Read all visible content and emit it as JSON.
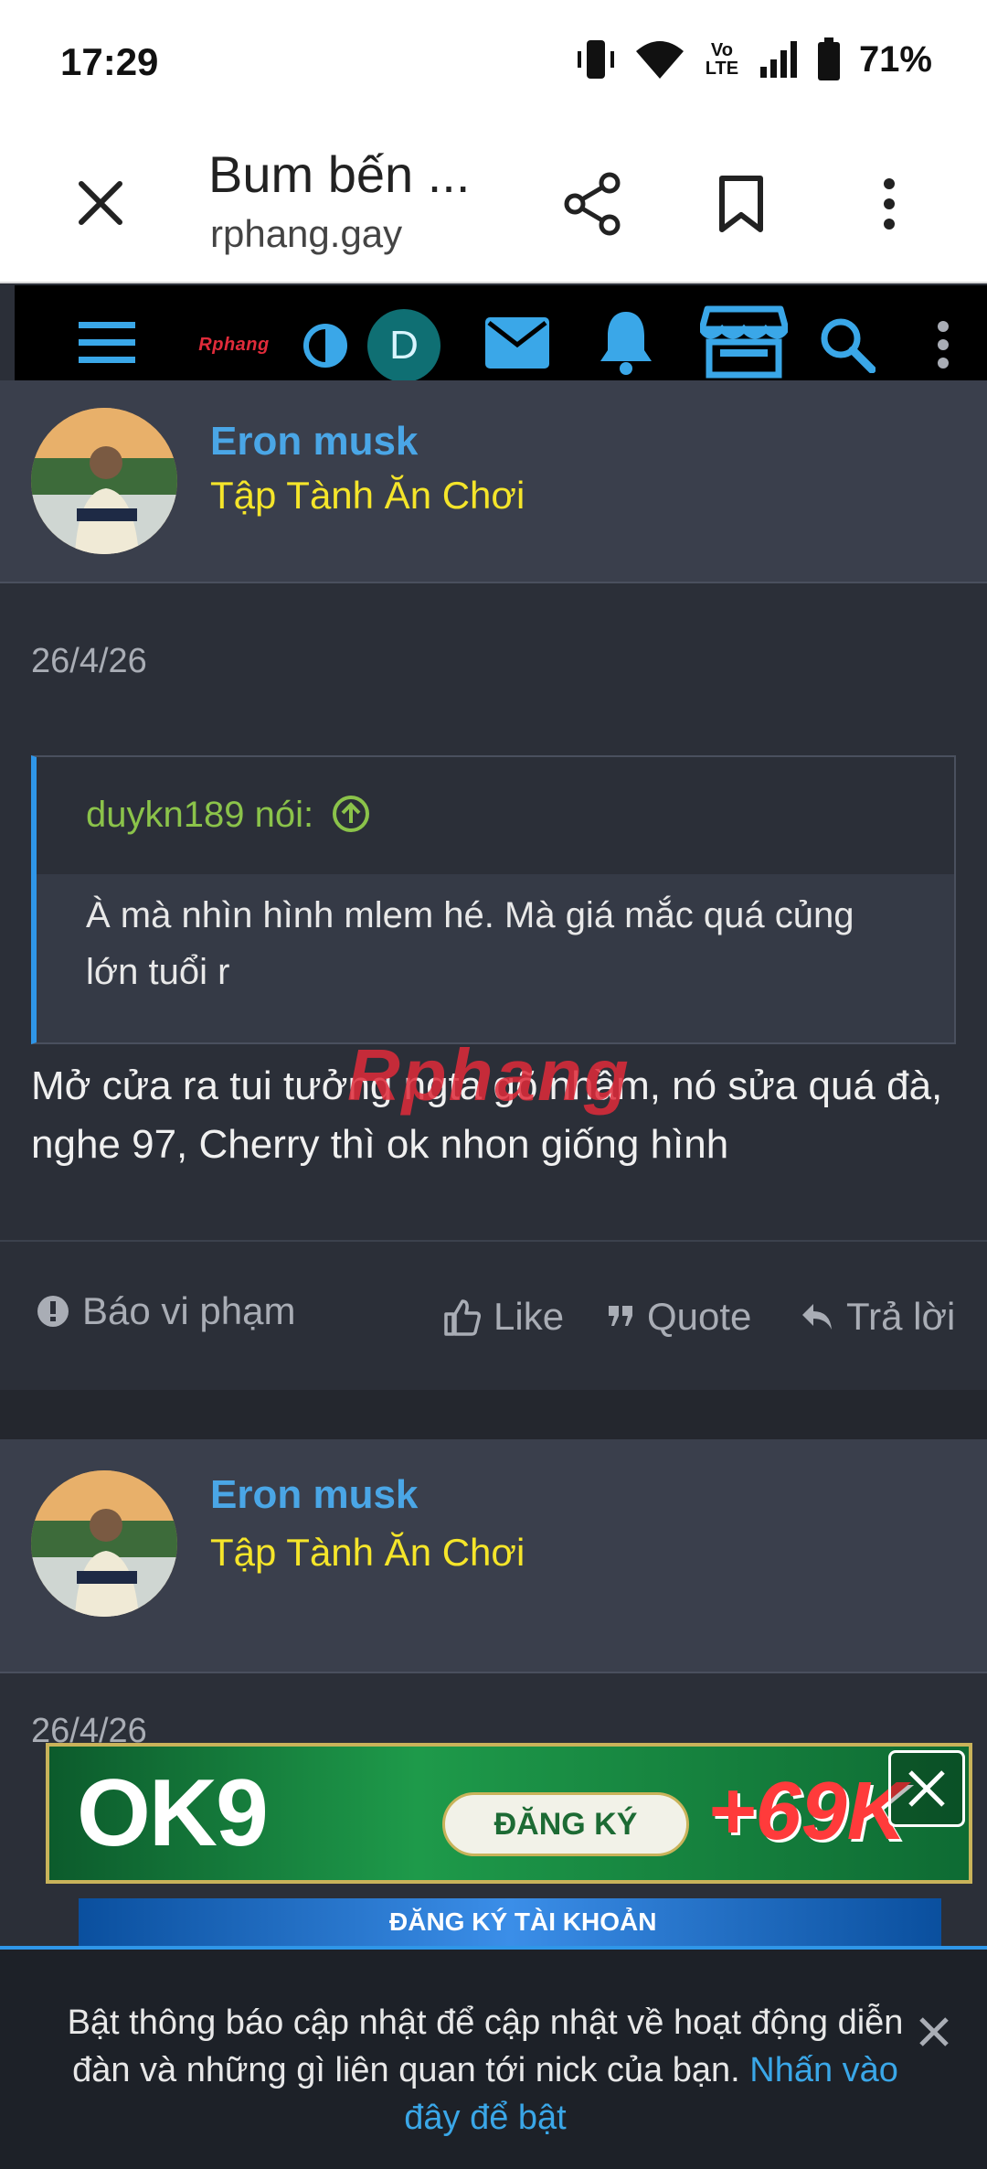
{
  "status": {
    "time": "17:29",
    "battery": "71%",
    "volte": "Vo LTE"
  },
  "browser": {
    "title": "Bum bến ...",
    "url": "rphang.gay"
  },
  "nav": {
    "logo": "Rphang",
    "avatar_letter": "D"
  },
  "posts": [
    {
      "username": "Eron musk",
      "user_title": "Tập Tành Ăn Chơi",
      "date": "26/4/26",
      "quote": {
        "author": "duykn189 nói:",
        "text": "À mà nhìn hình mlem hé. Mà giá mắc quá củng lớn tuổi r"
      },
      "message": "Mở cửa ra tui tưởng ngta gõ nhầm, nó sửa quá đà, nghe 97, Cherry thì ok nhon giống hình",
      "actions": {
        "report": "Báo vi phạm",
        "like": "Like",
        "quote": "Quote",
        "reply": "Trả lời"
      }
    },
    {
      "username": "Eron musk",
      "user_title": "Tập Tành Ăn Chơi",
      "date": "26/4/26"
    }
  ],
  "watermark": "Rphang",
  "ad": {
    "brand": "OK9",
    "cta": "ĐĂNG KÝ",
    "bonus": "+69K",
    "sub_cta": "ĐĂNG KÝ TÀI KHOẢN"
  },
  "notification": {
    "text": "Bật thông báo cập nhật để cập nhật về hoạt động diễn đàn và những gì liên quan tới nick của bạn.",
    "link": "Nhấn vào đây để bật"
  },
  "colors": {
    "username": "#4aa6e6",
    "user_title": "#f5e52a",
    "quote_author": "#8bc34a",
    "accent": "#2f96e8"
  }
}
